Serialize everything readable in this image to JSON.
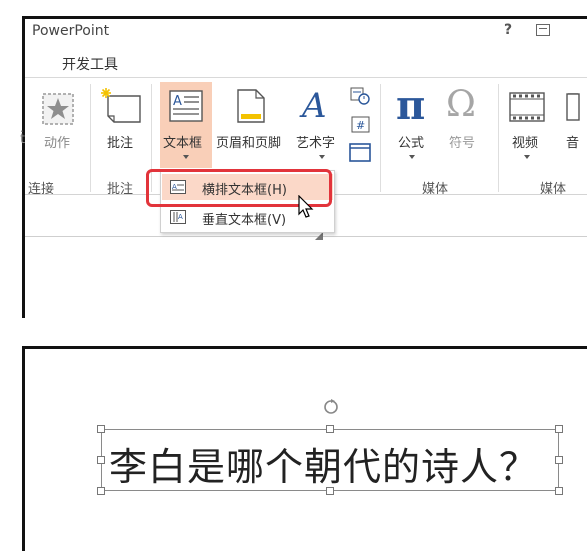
{
  "app": {
    "title": "PowerPoint",
    "help": "?",
    "active_tab": "开发工具"
  },
  "ribbon": {
    "partial_left_label": "接",
    "buttons": {
      "action": "动作",
      "comment": "批注",
      "textbox": "文本框",
      "header_footer": "页眉和页脚",
      "wordart": "艺术字",
      "equation": "公式",
      "symbol": "符号",
      "video": "视频",
      "audio_partial": "音"
    },
    "groups": {
      "links_partial": "连接",
      "comments": "批注",
      "media": "媒体",
      "symbols": "媒体"
    },
    "icons": {
      "pi": "π",
      "omega": "Ω",
      "wordart_glyph": "A"
    }
  },
  "dropdown": {
    "items": [
      {
        "label": "横排文本框(H)",
        "icon": "horizontal-textbox-icon",
        "highlighted": true
      },
      {
        "label": "垂直文本框(V)",
        "icon": "vertical-textbox-icon",
        "highlighted": false
      }
    ]
  },
  "slide": {
    "text": "李白是哪个朝代的诗人？"
  },
  "colors": {
    "accent_selected": "#f9cfb8",
    "highlight_box": "#e2343b",
    "menu_highlight": "#fbd8c8",
    "pi_blue": "#2b579a"
  }
}
